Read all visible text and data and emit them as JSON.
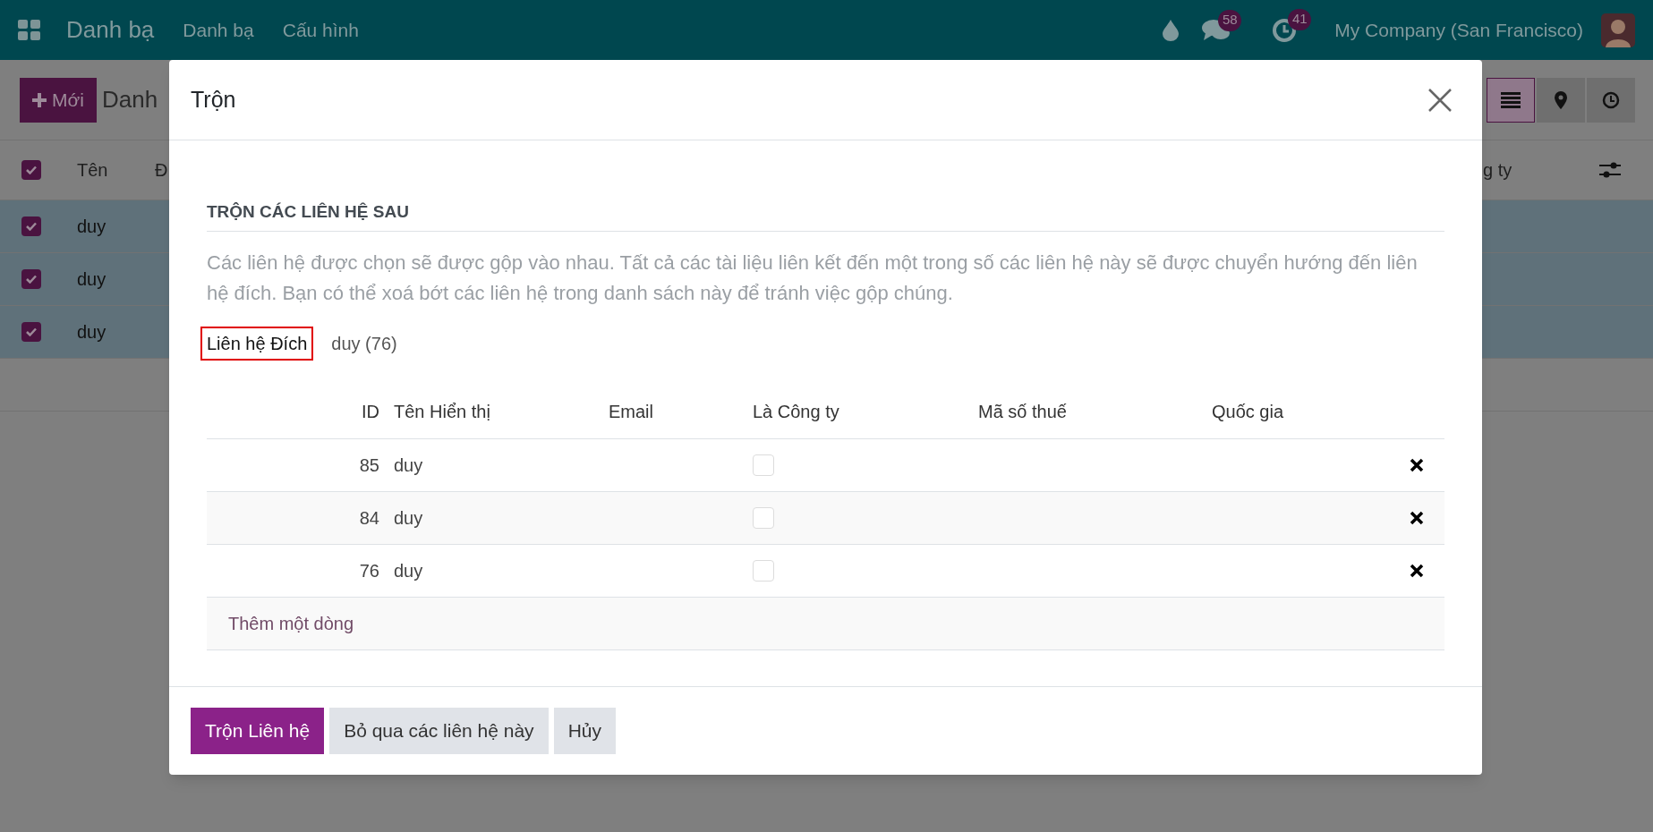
{
  "navbar": {
    "app_name": "Danh bạ",
    "menu": [
      "Danh bạ",
      "Cấu hình"
    ],
    "messages_count": "58",
    "activities_count": "41",
    "company": "My Company (San Francisco)"
  },
  "control_panel": {
    "new_button": "Mới",
    "breadcrumb": "Danh",
    "views": [
      {
        "kind": "list",
        "selected": true
      },
      {
        "kind": "map",
        "selected": false
      },
      {
        "kind": "activity",
        "selected": false
      }
    ]
  },
  "list": {
    "select_all": true,
    "columns": [
      "Tên",
      "Đ",
      "g ty"
    ],
    "rows": [
      {
        "name": "duy",
        "selected": true
      },
      {
        "name": "duy",
        "selected": true
      },
      {
        "name": "duy",
        "selected": true
      }
    ]
  },
  "dialog": {
    "title": "Trộn",
    "section_title": "TRỘN CÁC LIÊN HỆ SAU",
    "description": "Các liên hệ được chọn sẽ được gộp vào nhau. Tất cả các tài liệu liên kết đến một trong số các liên hệ này sẽ được chuyển hướng đến liên hệ đích. Bạn có thể xoá bớt các liên hệ trong danh sách này để tránh việc gộp chúng.",
    "destination_label": "Liên hệ Đích",
    "destination_value": "duy (76)",
    "columns": [
      "ID",
      "Tên Hiển thị",
      "Email",
      "Là Công ty",
      "Mã số thuế",
      "Quốc gia"
    ],
    "rows": [
      {
        "id": "85",
        "name": "duy",
        "is_company": false
      },
      {
        "id": "84",
        "name": "duy",
        "is_company": false
      },
      {
        "id": "76",
        "name": "duy",
        "is_company": false
      }
    ],
    "add_line": "Thêm một dòng",
    "buttons": [
      {
        "label": "Trộn Liên hệ",
        "kind": "primary"
      },
      {
        "label": "Bỏ qua các liên hệ này",
        "kind": "secondary"
      },
      {
        "label": "Hủy",
        "kind": "secondary"
      }
    ]
  }
}
